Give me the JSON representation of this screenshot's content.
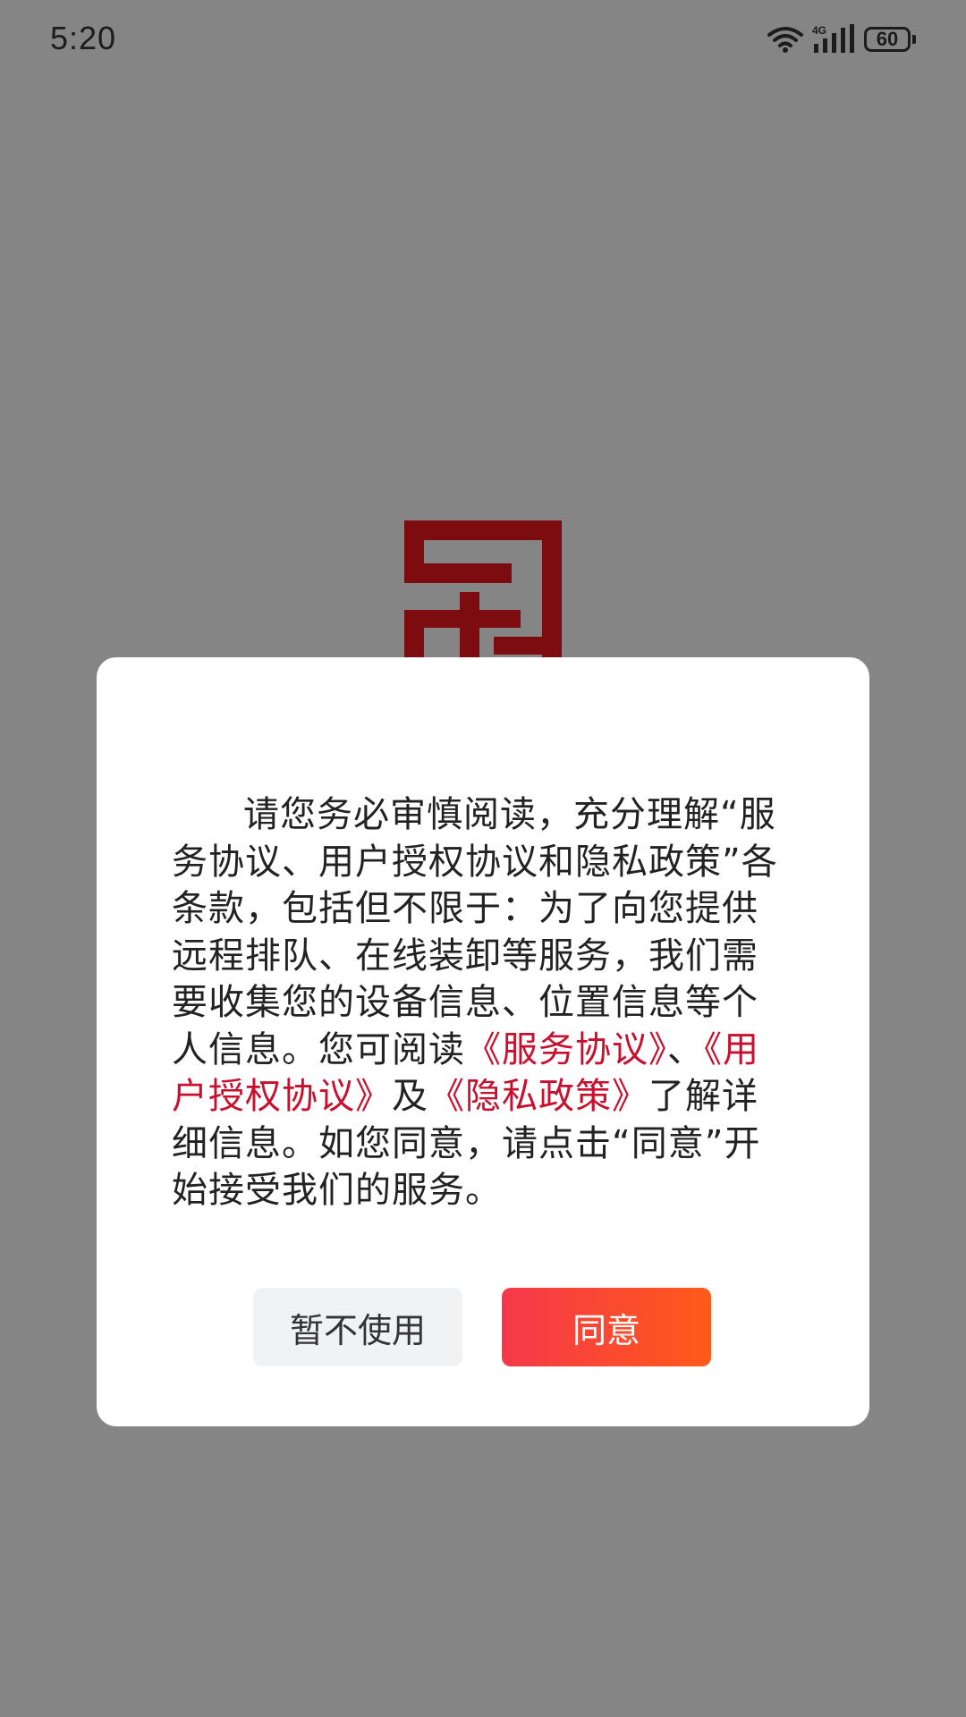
{
  "status_bar": {
    "time": "5:20",
    "network": "4G",
    "battery_level": "60",
    "icons": [
      "wifi-icon",
      "cellular-signal-icon",
      "battery-icon"
    ]
  },
  "logo": {
    "icon": "brand-logo-icon",
    "color": "#8b0f14"
  },
  "dialog": {
    "text_intro": "请您务必审慎阅读，充分理解“服务协议、用户授权协议和隐私政策”各条款，包括但不限于：为了向您提供远程排队、在线装卸等服务，我们需要收集您的设备信息、位置信息等个人信息。您可阅读",
    "link_service_agreement": "《服务协议》",
    "separator": "、",
    "link_user_authorization": "《用户授权协议》",
    "conjunction": "及",
    "link_privacy_policy": "《隐私政策》",
    "text_outro": "了解详细信息。如您同意，请点击“同意”开始接受我们的服务。",
    "decline_label": "暂不使用",
    "agree_label": "同意"
  },
  "colors": {
    "overlay_background": "#858585",
    "link": "#c8102e",
    "agree_gradient_start": "#f5384a",
    "agree_gradient_end": "#ff5a1a",
    "decline_background": "#f1f2f4"
  }
}
